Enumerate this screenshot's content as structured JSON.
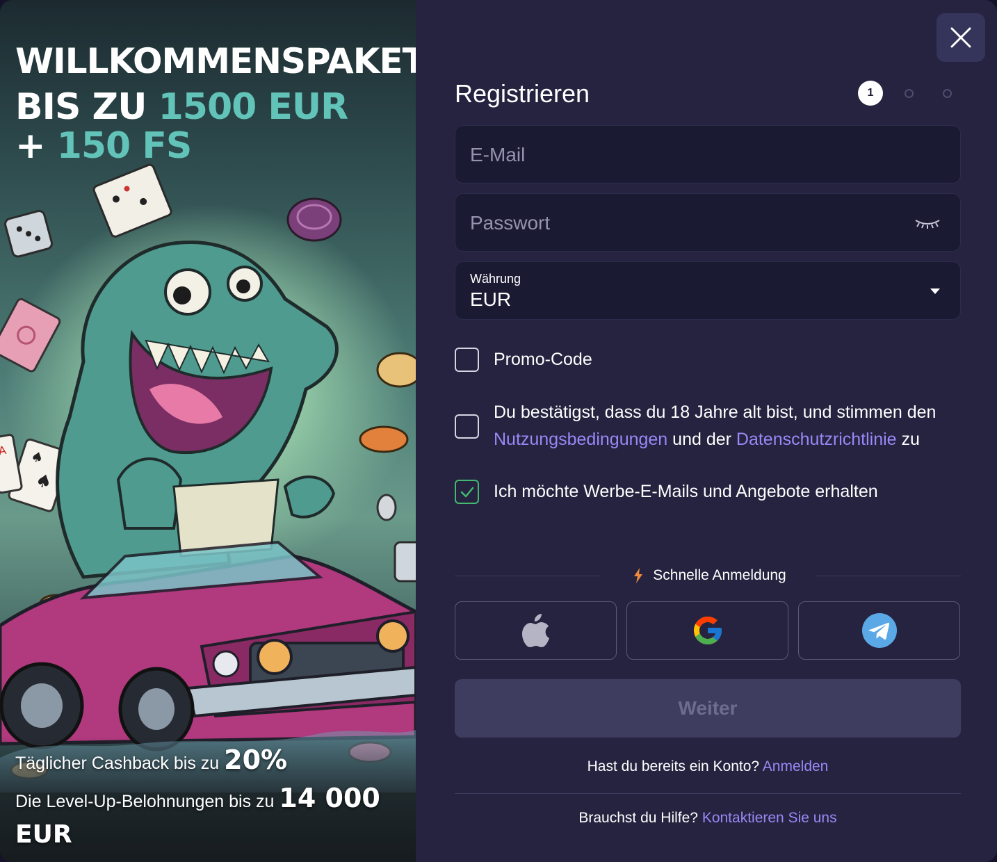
{
  "promo": {
    "title_line1": "WILLKOMMENSPAKET",
    "title_line2_prefix": "BIS ZU ",
    "title_line2_accent": "1500 EUR",
    "title_line3_prefix": "+ ",
    "title_line3_accent": "150 FS",
    "cashback_text": "Täglicher Cashback bis zu ",
    "cashback_value": "20%",
    "levelup_text": "Die Level-Up-Belohnungen bis zu ",
    "levelup_value": "14 000",
    "levelup_currency": "EUR",
    "accent_color": "#62c3b8"
  },
  "header": {
    "title": "Registrieren",
    "current_step": "1",
    "total_steps": 3
  },
  "form": {
    "email": {
      "placeholder": "E-Mail",
      "value": ""
    },
    "password": {
      "placeholder": "Passwort",
      "value": ""
    },
    "currency": {
      "label": "Währung",
      "value": "EUR"
    },
    "promo_code": {
      "label": "Promo-Code",
      "checked": false
    },
    "terms": {
      "checked": false,
      "text_before": "Du bestätigst, dass du 18 Jahre alt bist, und stimmen den ",
      "link1": "Nutzungsbedingungen",
      "text_middle": " und der ",
      "link2": "Datenschutzrichtlinie",
      "text_after": " zu"
    },
    "marketing": {
      "label": "Ich möchte Werbe-E-Mails und Angebote erhalten",
      "checked": true
    }
  },
  "quick_login": {
    "label": "Schnelle Anmeldung",
    "providers": [
      "apple-icon",
      "google-icon",
      "telegram-icon"
    ]
  },
  "submit": {
    "label": "Weiter"
  },
  "footer": {
    "account_text": "Hast du bereits ein Konto? ",
    "login_link": "Anmelden",
    "help_text": "Brauchst du Hilfe? ",
    "contact_link": "Kontaktieren Sie uns"
  },
  "colors": {
    "panel_bg": "#25233f",
    "field_bg": "#1b1a33",
    "link": "#9b87f7",
    "check_green": "#43b971",
    "submit_disabled": "#3e3d5f"
  }
}
